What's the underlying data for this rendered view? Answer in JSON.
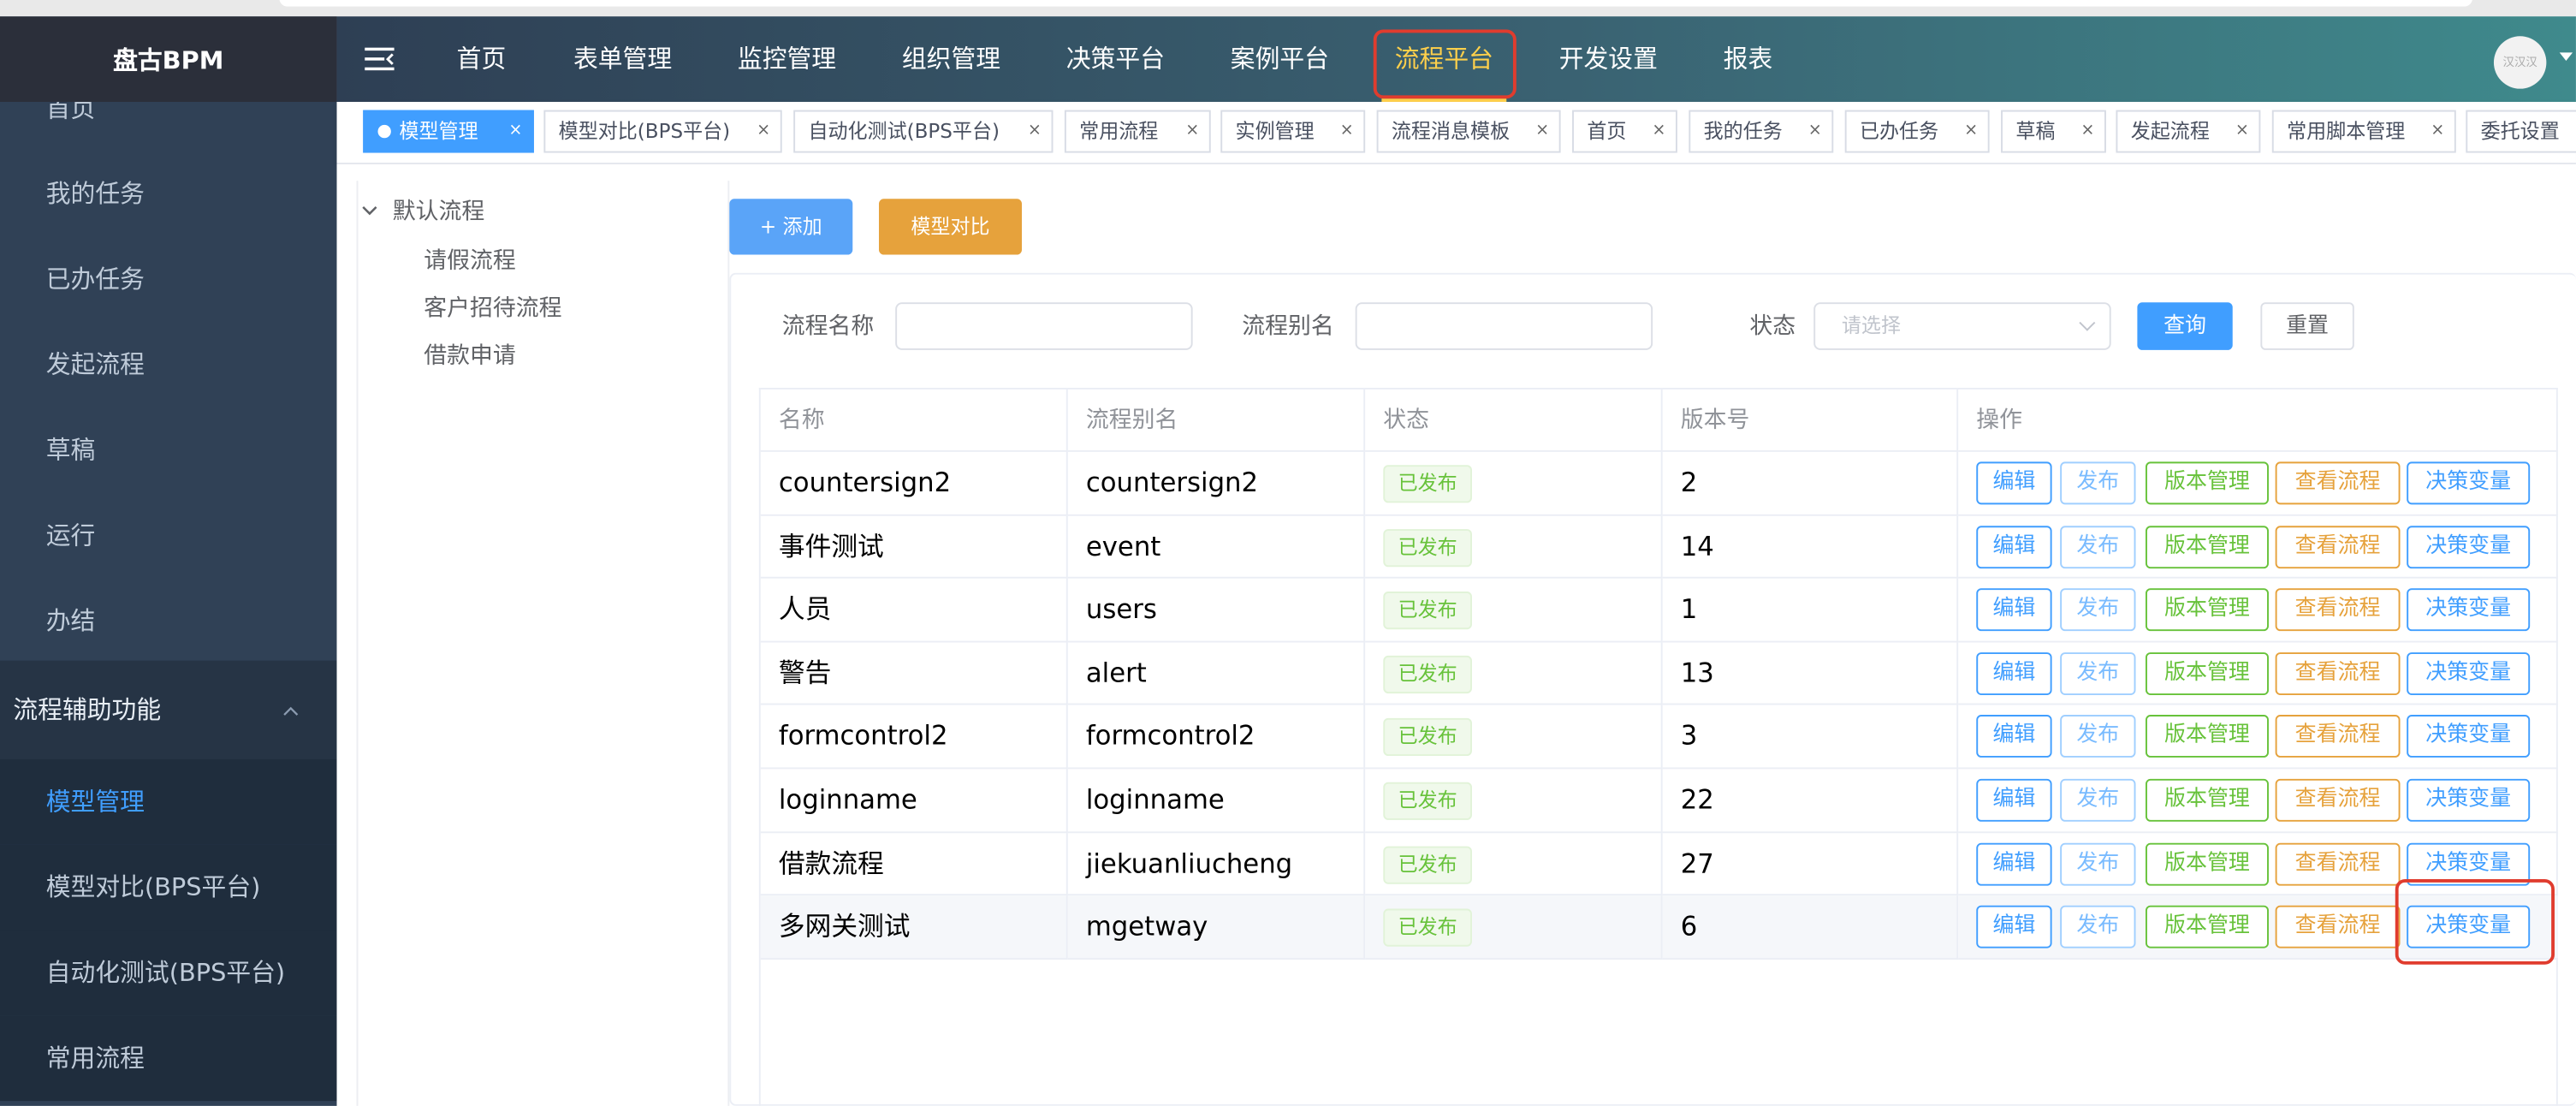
{
  "app": {
    "title": "盘古BPM"
  },
  "colors": {
    "sidebar_bg": "#304156",
    "primary": "#409eff",
    "warning": "#e6a23c",
    "success": "#67c23a",
    "highlight_box": "#e03c2e"
  },
  "sidebar": {
    "items": [
      {
        "label": "首页"
      },
      {
        "label": "我的任务"
      },
      {
        "label": "已办任务"
      },
      {
        "label": "发起流程"
      },
      {
        "label": "草稿"
      },
      {
        "label": "运行"
      },
      {
        "label": "办结"
      }
    ],
    "group": {
      "label": "流程辅助功能",
      "icon": "chevron-up-icon"
    },
    "sub_items": [
      {
        "label": "模型管理",
        "active": true
      },
      {
        "label": "模型对比(BPS平台)"
      },
      {
        "label": "自动化测试(BPS平台)"
      },
      {
        "label": "常用流程"
      }
    ]
  },
  "navbar": {
    "menu_icon": "hamburger-icon",
    "items": [
      {
        "label": "首页"
      },
      {
        "label": "表单管理"
      },
      {
        "label": "监控管理"
      },
      {
        "label": "组织管理"
      },
      {
        "label": "决策平台"
      },
      {
        "label": "案例平台"
      },
      {
        "label": "流程平台",
        "active": true
      },
      {
        "label": "开发设置"
      },
      {
        "label": "报表"
      }
    ],
    "avatar_text": "汉汉汉"
  },
  "tags": [
    {
      "label": "模型管理",
      "active": true
    },
    {
      "label": "模型对比(BPS平台)"
    },
    {
      "label": "自动化测试(BPS平台)"
    },
    {
      "label": "常用流程"
    },
    {
      "label": "实例管理"
    },
    {
      "label": "流程消息模板"
    },
    {
      "label": "首页"
    },
    {
      "label": "我的任务"
    },
    {
      "label": "已办任务"
    },
    {
      "label": "草稿"
    },
    {
      "label": "发起流程"
    },
    {
      "label": "常用脚本管理"
    },
    {
      "label": "委托设置"
    }
  ],
  "tag_close": "×",
  "tree": {
    "root": "默认流程",
    "children": [
      "请假流程",
      "客户招待流程",
      "借款申请"
    ]
  },
  "toolbar": {
    "add_label": "+ 添加",
    "compare_label": "模型对比"
  },
  "search": {
    "name_label": "流程名称",
    "name_value": "",
    "alias_label": "流程别名",
    "alias_value": "",
    "status_label": "状态",
    "status_placeholder": "请选择",
    "query_label": "查询",
    "reset_label": "重置"
  },
  "table": {
    "columns": [
      "名称",
      "流程别名",
      "状态",
      "版本号",
      "操作"
    ],
    "actions": [
      "编辑",
      "发布",
      "版本管理",
      "查看流程",
      "决策变量"
    ],
    "rows": [
      {
        "name": "countersign2",
        "alias": "countersign2",
        "status": "已发布",
        "version": "2"
      },
      {
        "name": "事件测试",
        "alias": "event",
        "status": "已发布",
        "version": "14"
      },
      {
        "name": "人员",
        "alias": "users",
        "status": "已发布",
        "version": "1"
      },
      {
        "name": "警告",
        "alias": "alert",
        "status": "已发布",
        "version": "13"
      },
      {
        "name": "formcontrol2",
        "alias": "formcontrol2",
        "status": "已发布",
        "version": "3"
      },
      {
        "name": "loginname",
        "alias": "loginname",
        "status": "已发布",
        "version": "22"
      },
      {
        "name": "借款流程",
        "alias": "jiekuanliucheng",
        "status": "已发布",
        "version": "27"
      },
      {
        "name": "多网关测试",
        "alias": "mgetway",
        "status": "已发布",
        "version": "6"
      }
    ]
  }
}
